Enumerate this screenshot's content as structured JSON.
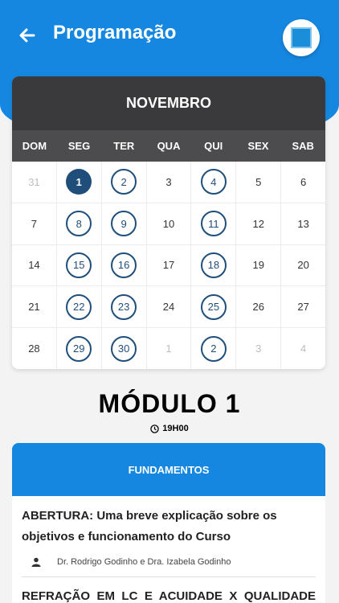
{
  "header": {
    "title": "Programação"
  },
  "calendar": {
    "month": "NOVEMBRO",
    "weekdays": [
      "DOM",
      "SEG",
      "TER",
      "QUA",
      "QUI",
      "SEX",
      "SAB"
    ],
    "weeks": [
      [
        {
          "d": "31",
          "s": "outside"
        },
        {
          "d": "1",
          "s": "selected"
        },
        {
          "d": "2",
          "s": "event"
        },
        {
          "d": "3",
          "s": "normal"
        },
        {
          "d": "4",
          "s": "event"
        },
        {
          "d": "5",
          "s": "normal"
        },
        {
          "d": "6",
          "s": "normal"
        }
      ],
      [
        {
          "d": "7",
          "s": "normal"
        },
        {
          "d": "8",
          "s": "event"
        },
        {
          "d": "9",
          "s": "event"
        },
        {
          "d": "10",
          "s": "normal"
        },
        {
          "d": "11",
          "s": "event"
        },
        {
          "d": "12",
          "s": "normal"
        },
        {
          "d": "13",
          "s": "normal"
        }
      ],
      [
        {
          "d": "14",
          "s": "normal"
        },
        {
          "d": "15",
          "s": "event"
        },
        {
          "d": "16",
          "s": "event"
        },
        {
          "d": "17",
          "s": "normal"
        },
        {
          "d": "18",
          "s": "event"
        },
        {
          "d": "19",
          "s": "normal"
        },
        {
          "d": "20",
          "s": "normal"
        }
      ],
      [
        {
          "d": "21",
          "s": "normal"
        },
        {
          "d": "22",
          "s": "event"
        },
        {
          "d": "23",
          "s": "event"
        },
        {
          "d": "24",
          "s": "normal"
        },
        {
          "d": "25",
          "s": "event"
        },
        {
          "d": "26",
          "s": "normal"
        },
        {
          "d": "27",
          "s": "normal"
        }
      ],
      [
        {
          "d": "28",
          "s": "normal"
        },
        {
          "d": "29",
          "s": "event"
        },
        {
          "d": "30",
          "s": "event"
        },
        {
          "d": "1",
          "s": "outside"
        },
        {
          "d": "2",
          "s": "event"
        },
        {
          "d": "3",
          "s": "outside"
        },
        {
          "d": "4",
          "s": "outside"
        }
      ]
    ]
  },
  "module": {
    "title": "MÓDULO 1",
    "time": "19H00"
  },
  "section": {
    "heading": "FUNDAMENTOS",
    "items": [
      {
        "title": "ABERTURA: Uma breve explicação sobre os objetivos e funcionamento do Curso",
        "author": "Dr. Rodrigo Godinho e Dra. Izabela Godinho"
      },
      {
        "title": "REFRAÇÃO EM LC E ACUIDADE X QUALIDADE"
      }
    ]
  },
  "colors": {
    "primary": "#1587e0",
    "dark": "#3a3a3c",
    "event": "#1f4e7a"
  },
  "icons": {
    "back": "arrow-left-icon",
    "clock": "clock-icon",
    "person": "person-icon"
  }
}
